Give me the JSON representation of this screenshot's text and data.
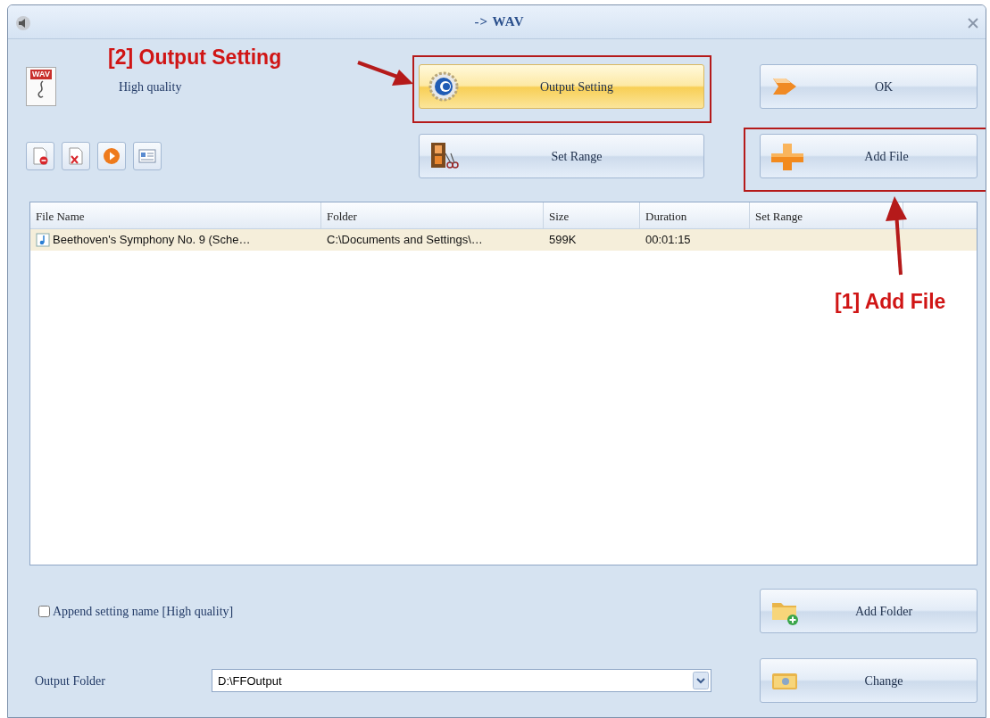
{
  "window": {
    "title": "-> WAV"
  },
  "profile": {
    "icon_label": "WAV",
    "quality": "High quality"
  },
  "toolbar": [
    {
      "kind": "remove"
    },
    {
      "kind": "clear"
    },
    {
      "kind": "play"
    },
    {
      "kind": "info"
    }
  ],
  "buttons": [
    {
      "kind": "settings",
      "label": "Output Setting",
      "highlighted": true
    },
    {
      "kind": "ok",
      "label": "OK",
      "highlighted": false
    },
    {
      "kind": "range",
      "label": "Set Range",
      "highlighted": false
    },
    {
      "kind": "add",
      "label": "Add File",
      "highlighted": false
    }
  ],
  "table": {
    "columns": [
      "File Name",
      "Folder",
      "Size",
      "Duration",
      "Set Range"
    ],
    "rows": [
      {
        "cells": [
          "Beethoven's Symphony No. 9 (Sche…",
          "C:\\Documents and Settings\\…",
          "599K",
          "00:01:15",
          ""
        ],
        "selected": true
      }
    ]
  },
  "append_setting": {
    "label": "Append setting name [High quality]",
    "checked": false
  },
  "add_folder": {
    "label": "Add Folder"
  },
  "output_folder": {
    "label": "Output Folder",
    "value": "D:\\FFOutput"
  },
  "change": {
    "label": "Change"
  },
  "annotations": [
    {
      "text": "[2] Output Setting"
    },
    {
      "text": "[1] Add File"
    }
  ]
}
